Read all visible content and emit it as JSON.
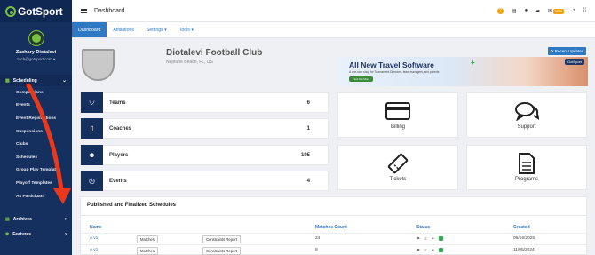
{
  "app": {
    "logo_text": "GotSport"
  },
  "user": {
    "name": "Zachary Diotalevi",
    "email": "zach@gotsport.com"
  },
  "sidebar": {
    "group": {
      "label": "Scheduling"
    },
    "items": [
      {
        "label": "Competitions"
      },
      {
        "label": "Events"
      },
      {
        "label": "Event Registrations"
      },
      {
        "label": "Suspensions"
      },
      {
        "label": "Clubs"
      },
      {
        "label": "Schedules"
      },
      {
        "label": "Group Play Templates"
      },
      {
        "label": "Playoff Templates"
      },
      {
        "label": "As Participant"
      }
    ],
    "lower": [
      {
        "label": "Archives"
      },
      {
        "label": "Features"
      }
    ]
  },
  "topbar": {
    "title": "Dashboard",
    "badge": "NEW"
  },
  "tabs": [
    {
      "label": "Dashboard"
    },
    {
      "label": "Affiliations"
    },
    {
      "label": "Settings"
    },
    {
      "label": "Tools"
    }
  ],
  "club": {
    "name": "Diotalevi Football Club",
    "location": "Neptune Beach, FL, US"
  },
  "recent_updates_label": "Recent Updates",
  "banner": {
    "title": "All New Travel Software",
    "subtitle": "A one-stop shop for Tournament Directors, team managers, and parents",
    "button": "Find Out More",
    "brand": "GotSport"
  },
  "stats": [
    {
      "label": "Teams",
      "value": "6",
      "icon": "shield-icon"
    },
    {
      "label": "Coaches",
      "value": "1",
      "icon": "clipboard-icon"
    },
    {
      "label": "Players",
      "value": "195",
      "icon": "users-icon"
    },
    {
      "label": "Events",
      "value": "4",
      "icon": "clock-icon"
    }
  ],
  "tiles": [
    {
      "label": "Billing",
      "icon": "credit-card-icon"
    },
    {
      "label": "Support",
      "icon": "chat-bubbles-icon"
    },
    {
      "label": "Tickets",
      "icon": "ticket-icon"
    },
    {
      "label": "Programs",
      "icon": "document-icon"
    }
  ],
  "schedules": {
    "title": "Published and Finalized Schedules",
    "columns": [
      "Name",
      "Matches Count",
      "Status",
      "Created"
    ],
    "rows": [
      {
        "name": "A v1",
        "matches_btn": "Matches",
        "report_btn": "Constraints Report",
        "count": "24",
        "created": "06/16/2025"
      },
      {
        "name": "A v1",
        "matches_btn": "Matches",
        "report_btn": "Constraints Report",
        "count": "8",
        "created": "11/05/2024"
      }
    ]
  },
  "colors": {
    "sidebar": "#15305f",
    "accent": "#2f78c4",
    "green": "#7ac143",
    "arrow": "#e8391d"
  }
}
